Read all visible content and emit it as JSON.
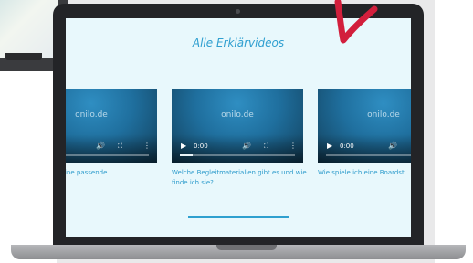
{
  "page": {
    "title": "Alle Erklärvideos"
  },
  "videos": [
    {
      "watermark": "onilo.de",
      "time": "",
      "caption": "h eine passende",
      "progress": 0.0
    },
    {
      "watermark": "onilo.de",
      "time": "0:00",
      "caption": "Welche Begleitmaterialien gibt es und wie finde ich sie?",
      "progress": 0.12
    },
    {
      "watermark": "onilo.de",
      "time": "0:00",
      "caption": "Wie spiele ich eine Boardst",
      "progress": 0.0
    }
  ],
  "icons": {
    "play": "▶",
    "volume": "🔊",
    "fullscreen": "⛶",
    "more": "⋮"
  },
  "colors": {
    "accent": "#2f9fd0",
    "screen_bg": "#e8f8fc",
    "laptop": "#232427",
    "annotation": "#d21f3c"
  }
}
